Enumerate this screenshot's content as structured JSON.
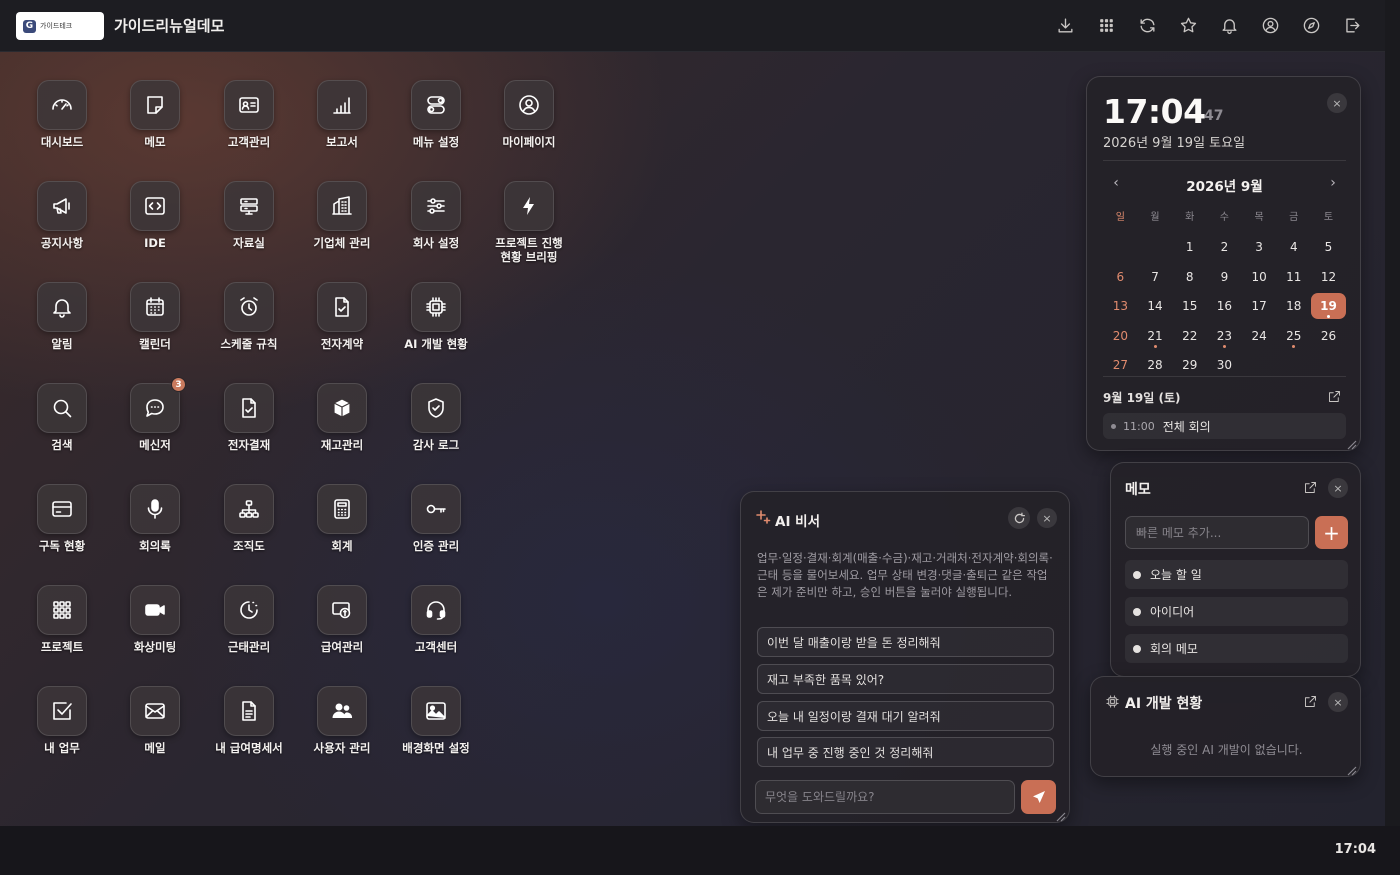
{
  "header": {
    "logo_mark": "G",
    "logo_text": "가이드테크",
    "title": "가이드리뉴얼데모",
    "icons": [
      "download-icon",
      "apps-grid-icon",
      "refresh-icon",
      "star-icon",
      "bell-icon",
      "user-icon",
      "compass-icon",
      "logout-icon"
    ]
  },
  "apps": [
    {
      "label": "대시보드",
      "icon": "gauge-icon"
    },
    {
      "label": "메모",
      "icon": "sticky-note-icon"
    },
    {
      "label": "고객관리",
      "icon": "id-card-icon"
    },
    {
      "label": "보고서",
      "icon": "bar-chart-icon"
    },
    {
      "label": "메뉴 설정",
      "icon": "toggle-icon"
    },
    {
      "label": "마이페이지",
      "icon": "user-circle-icon"
    },
    {
      "label": "공지사항",
      "icon": "megaphone-icon"
    },
    {
      "label": "IDE",
      "icon": "code-icon"
    },
    {
      "label": "자료실",
      "icon": "archive-icon"
    },
    {
      "label": "기업체 관리",
      "icon": "building-icon"
    },
    {
      "label": "회사 설정",
      "icon": "sliders-icon"
    },
    {
      "label": "프로젝트 진행",
      "label2": "현황 브리핑",
      "icon": "lightning-icon"
    },
    {
      "label": "알림",
      "icon": "bell-icon"
    },
    {
      "label": "캘린더",
      "icon": "calendar-icon"
    },
    {
      "label": "스케줄 규칙",
      "icon": "alarm-clock-icon"
    },
    {
      "label": "전자계약",
      "icon": "contract-icon"
    },
    {
      "label": "AI 개발 현황",
      "icon": "chip-icon"
    },
    {
      "label": "검색",
      "icon": "search-icon"
    },
    {
      "label": "메신저",
      "icon": "chat-icon",
      "badge": "3"
    },
    {
      "label": "전자결재",
      "icon": "approval-icon"
    },
    {
      "label": "재고관리",
      "icon": "box-icon"
    },
    {
      "label": "감사 로그",
      "icon": "shield-icon"
    },
    {
      "label": "구독 현황",
      "icon": "credit-card-icon"
    },
    {
      "label": "회의록",
      "icon": "microphone-icon"
    },
    {
      "label": "조직도",
      "icon": "org-chart-icon"
    },
    {
      "label": "회계",
      "icon": "calculator-icon"
    },
    {
      "label": "인증 관리",
      "icon": "key-icon"
    },
    {
      "label": "프로젝트",
      "icon": "grid-dots-icon"
    },
    {
      "label": "화상미팅",
      "icon": "video-icon"
    },
    {
      "label": "근태관리",
      "icon": "clock-icon"
    },
    {
      "label": "급여관리",
      "icon": "money-icon"
    },
    {
      "label": "고객센터",
      "icon": "headset-icon"
    },
    {
      "label": "내 업무",
      "icon": "checkbox-icon"
    },
    {
      "label": "메일",
      "icon": "mail-icon"
    },
    {
      "label": "내 급여명세서",
      "icon": "document-icon"
    },
    {
      "label": "사용자 관리",
      "icon": "users-icon"
    },
    {
      "label": "배경화면 설정",
      "icon": "image-icon"
    }
  ],
  "clock": {
    "time": "17:04",
    "seconds": "47",
    "date": "2026년 9월 19일 토요일"
  },
  "calendar": {
    "title": "2026년 9월",
    "weekdays": [
      "일",
      "월",
      "화",
      "수",
      "목",
      "금",
      "토"
    ],
    "weeks": [
      [
        "",
        "",
        "1",
        "2",
        "3",
        "4",
        "5"
      ],
      [
        "6",
        "7",
        "8",
        "9",
        "10",
        "11",
        "12"
      ],
      [
        "13",
        "14",
        "15",
        "16",
        "17",
        "18",
        "19"
      ],
      [
        "20",
        "21",
        "22",
        "23",
        "24",
        "25",
        "26"
      ],
      [
        "27",
        "28",
        "29",
        "30",
        "",
        "",
        ""
      ]
    ],
    "today": "19",
    "event_days": [
      "19",
      "21",
      "23",
      "25"
    ],
    "accent_color": "#c96f55",
    "schedule_date": "9월 19일 (토)",
    "events": [
      {
        "time": "11:00",
        "title": "전체 회의"
      }
    ]
  },
  "memo": {
    "title": "메모",
    "placeholder": "빠른 메모 추가...",
    "add_label": "+",
    "items": [
      "오늘 할 일",
      "아이디어",
      "회의 메모"
    ]
  },
  "ai_dev": {
    "title": "AI 개발 현황",
    "empty": "실행 중인 AI 개발이 없습니다."
  },
  "ai_assistant": {
    "title": "AI 비서",
    "description": "업무·일정·결재·회계(매출·수금)·재고·거래처·전자계약·회의록·근태 등을 물어보세요. 업무 상태 변경·댓글·출퇴근 같은 작업은 제가 준비만 하고, 승인 버튼을 눌러야 실행됩니다.",
    "suggestions": [
      "이번 달 매출이랑 받을 돈 정리해줘",
      "재고 부족한 품목 있어?",
      "오늘 내 일정이랑 결재 대기 알려줘",
      "내 업무 중 진행 중인 것 정리해줘"
    ],
    "placeholder": "무엇을 도와드릴까요?"
  },
  "taskbar": {
    "time": "17:04"
  },
  "close_label": "×"
}
